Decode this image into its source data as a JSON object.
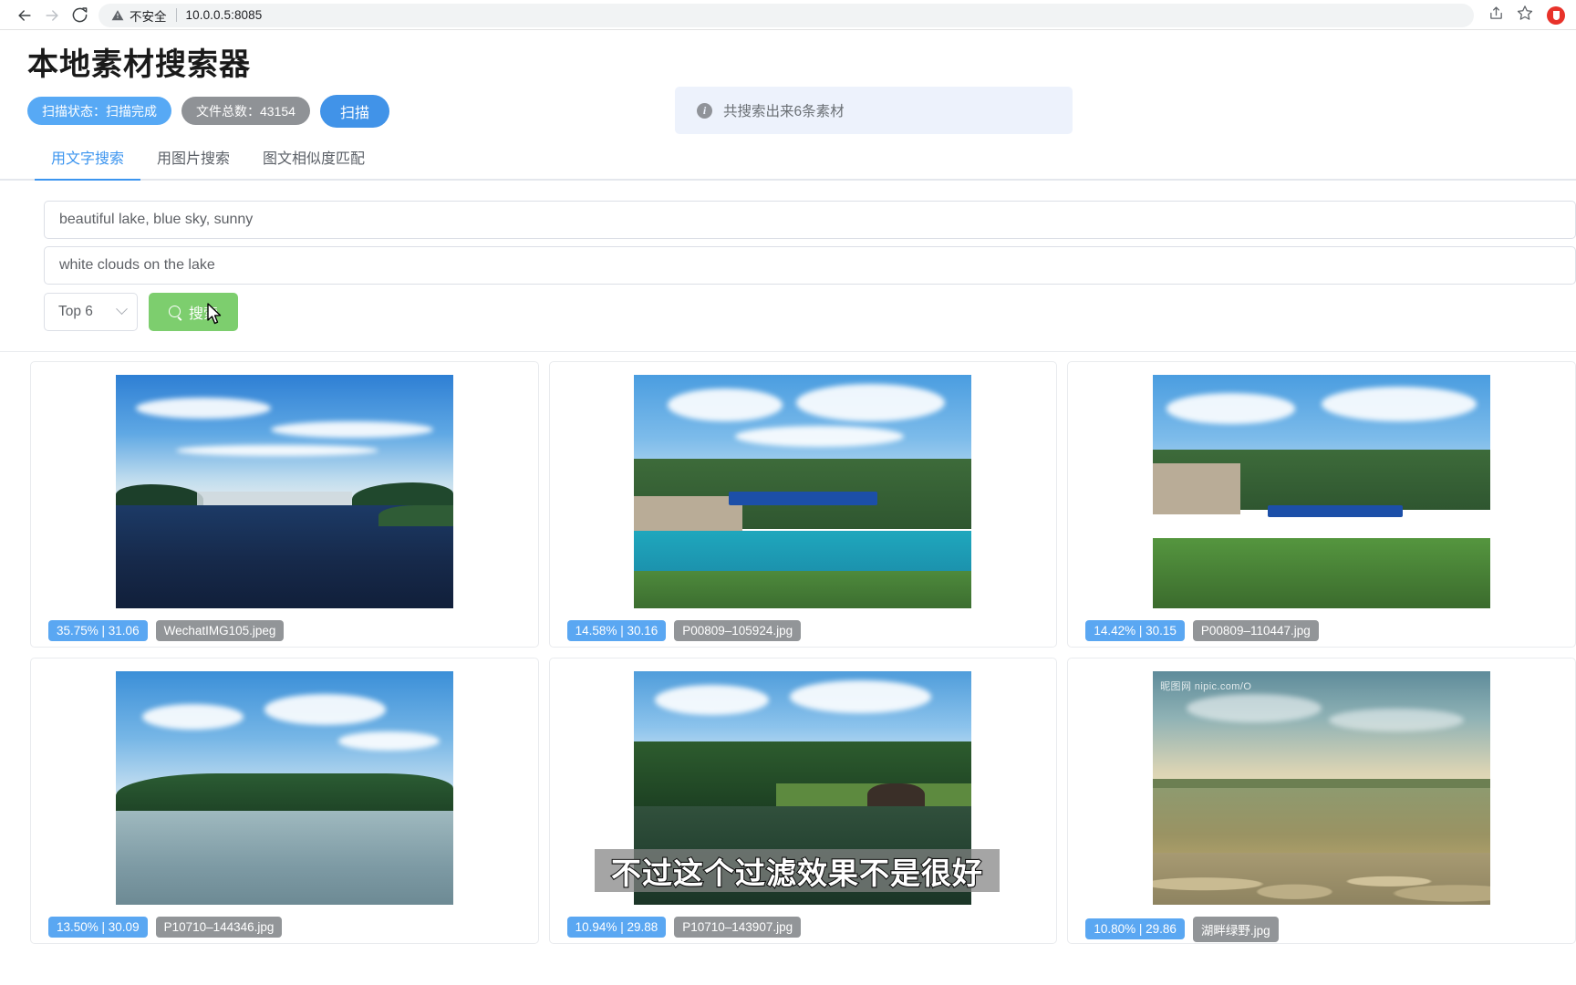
{
  "browser": {
    "back_icon": "back-arrow-icon",
    "forward_icon": "forward-arrow-icon",
    "reload_icon": "reload-icon",
    "security_warning": "不安全",
    "url": "10.0.0.5:8085",
    "share_icon": "share-icon",
    "bookmark_icon": "star-icon",
    "extension_icon": "adblock-extension-icon"
  },
  "header": {
    "title": "本地素材搜索器",
    "scan_status_label": "扫描状态：扫描完成",
    "file_count_label": "文件总数：43154",
    "scan_button": "扫描"
  },
  "info": {
    "icon": "info-icon",
    "message": "共搜索出来6条素材"
  },
  "tabs": [
    {
      "label": "用文字搜索",
      "active": true
    },
    {
      "label": "用图片搜索",
      "active": false
    },
    {
      "label": "图文相似度匹配",
      "active": false
    }
  ],
  "form": {
    "query_1": "beautiful lake, blue sky, sunny",
    "query_2": "white clouds on the lake",
    "top_select": "Top 6",
    "search_button": "搜索",
    "search_icon": "magnifier-icon",
    "chevron_icon": "chevron-down-icon"
  },
  "results": [
    {
      "score": "35.75% | 31.06",
      "filename": "WechatIMG105.jpeg",
      "photo": "p1",
      "watermark": ""
    },
    {
      "score": "14.58% | 30.16",
      "filename": "P00809–105924.jpg",
      "photo": "p2",
      "watermark": ""
    },
    {
      "score": "14.42% | 30.15",
      "filename": "P00809–110447.jpg",
      "photo": "p3",
      "watermark": ""
    },
    {
      "score": "13.50% | 30.09",
      "filename": "P10710–144346.jpg",
      "photo": "p4",
      "watermark": ""
    },
    {
      "score": "10.94% | 29.88",
      "filename": "P10710–143907.jpg",
      "photo": "p5",
      "watermark": ""
    },
    {
      "score": "10.80% | 29.86",
      "filename": "湖畔绿野.jpg",
      "photo": "p6",
      "watermark": "昵图网 nipic.com/O"
    }
  ],
  "overlay": {
    "subtitle": "不过这个过滤效果不是很好"
  },
  "colors": {
    "accent_blue": "#3c95ef",
    "badge_blue": "#5aa7f2",
    "badge_gray": "#929598",
    "search_green": "#7dce6e",
    "info_bg": "#edf2fc"
  }
}
